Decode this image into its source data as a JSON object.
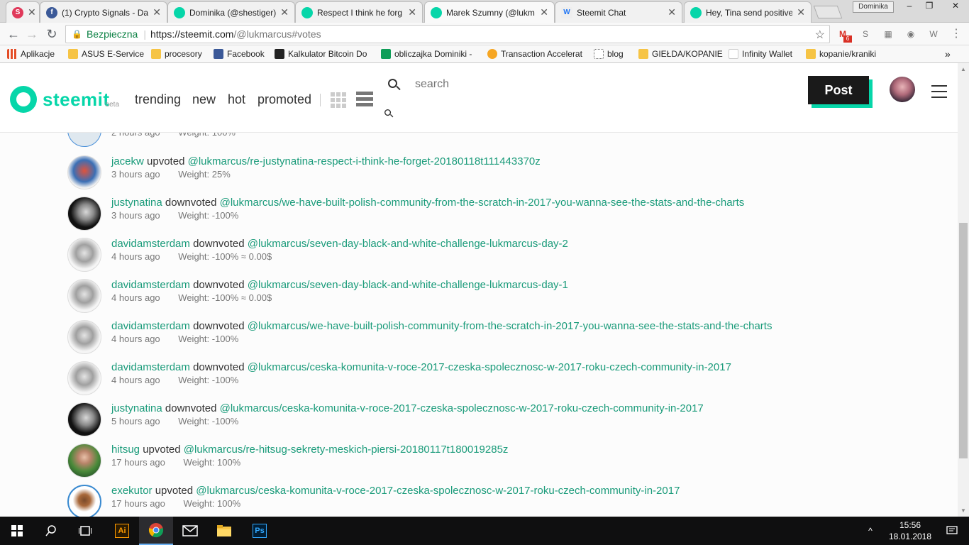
{
  "browser": {
    "tabs": [
      {
        "title": "",
        "favicon_color": "#e0395a"
      },
      {
        "title": "(1) Crypto Signals - Da",
        "favicon_color": "#3b5998"
      },
      {
        "title": "Dominika (@shestiger)",
        "favicon_color": "#06d6a9"
      },
      {
        "title": "Respect I think he forg",
        "favicon_color": "#06d6a9"
      },
      {
        "title": "Marek Szumny (@lukm",
        "favicon_color": "#06d6a9"
      },
      {
        "title": "Steemit Chat",
        "favicon_color": "#1d74f5"
      },
      {
        "title": "Hey, Tina send positive",
        "favicon_color": "#06d6a9"
      }
    ],
    "profile_name": "Dominika",
    "secure_label": "Bezpieczna",
    "url_host": "https://steemit.com",
    "url_path": "/@lukmarcus#votes",
    "gmail_badge": "6",
    "bookmarks": [
      {
        "label": "Aplikacje",
        "color": "#e34c26"
      },
      {
        "label": "ASUS E-Service",
        "color": "#f6c445"
      },
      {
        "label": "procesory",
        "color": "#f6c445"
      },
      {
        "label": "Facebook",
        "color": "#3b5998"
      },
      {
        "label": "Kalkulator Bitcoin Do",
        "color": "#222222"
      },
      {
        "label": "obliczajka Dominiki -",
        "color": "#0f9d58"
      },
      {
        "label": "Transaction Accelerat",
        "color": "#f6a623"
      },
      {
        "label": "blog",
        "color": "#666666"
      },
      {
        "label": "GIEŁDA/KOPANIE",
        "color": "#f6c445"
      },
      {
        "label": "Infinity Wallet",
        "color": "#dddddd"
      },
      {
        "label": "kopanie/kraniki",
        "color": "#f6c445"
      }
    ]
  },
  "steemit": {
    "logo_text": "steemit",
    "beta_label": "beta",
    "nav": [
      "trending",
      "new",
      "hot",
      "promoted"
    ],
    "search_placeholder": "search",
    "post_label": "Post"
  },
  "partial_row": {
    "time": "2 hours ago",
    "weight": "Weight: 100%"
  },
  "votes": [
    {
      "user": "jacekw",
      "action": "upvoted",
      "permlink": "@lukmarcus/re-justynatina-respect-i-think-he-forget-20180118t111443370z",
      "time": "3 hours ago",
      "weight": "Weight: 25%"
    },
    {
      "user": "justynatina",
      "action": "downvoted",
      "permlink": "@lukmarcus/we-have-built-polish-community-from-the-scratch-in-2017-you-wanna-see-the-stats-and-the-charts",
      "time": "3 hours ago",
      "weight": "Weight: -100%"
    },
    {
      "user": "davidamsterdam",
      "action": "downvoted",
      "permlink": "@lukmarcus/seven-day-black-and-white-challenge-lukmarcus-day-2",
      "time": "4 hours ago",
      "weight": "Weight: -100% ≈ 0.00$"
    },
    {
      "user": "davidamsterdam",
      "action": "downvoted",
      "permlink": "@lukmarcus/seven-day-black-and-white-challenge-lukmarcus-day-1",
      "time": "4 hours ago",
      "weight": "Weight: -100% ≈ 0.00$"
    },
    {
      "user": "davidamsterdam",
      "action": "downvoted",
      "permlink": "@lukmarcus/we-have-built-polish-community-from-the-scratch-in-2017-you-wanna-see-the-stats-and-the-charts",
      "time": "4 hours ago",
      "weight": "Weight: -100%"
    },
    {
      "user": "davidamsterdam",
      "action": "downvoted",
      "permlink": "@lukmarcus/ceska-komunita-v-roce-2017-czeska-spolecznosc-w-2017-roku-czech-community-in-2017",
      "time": "4 hours ago",
      "weight": "Weight: -100%"
    },
    {
      "user": "justynatina",
      "action": "downvoted",
      "permlink": "@lukmarcus/ceska-komunita-v-roce-2017-czeska-spolecznosc-w-2017-roku-czech-community-in-2017",
      "time": "5 hours ago",
      "weight": "Weight: -100%"
    },
    {
      "user": "hitsug",
      "action": "upvoted",
      "permlink": "@lukmarcus/re-hitsug-sekrety-meskich-piersi-20180117t180019285z",
      "time": "17 hours ago",
      "weight": "Weight: 100%"
    },
    {
      "user": "exekutor",
      "action": "upvoted",
      "permlink": "@lukmarcus/ceska-komunita-v-roce-2017-czeska-spolecznosc-w-2017-roku-czech-community-in-2017",
      "time": "17 hours ago",
      "weight": "Weight: 100%"
    }
  ],
  "taskbar": {
    "time": "15:56",
    "date": "18.01.2018"
  }
}
